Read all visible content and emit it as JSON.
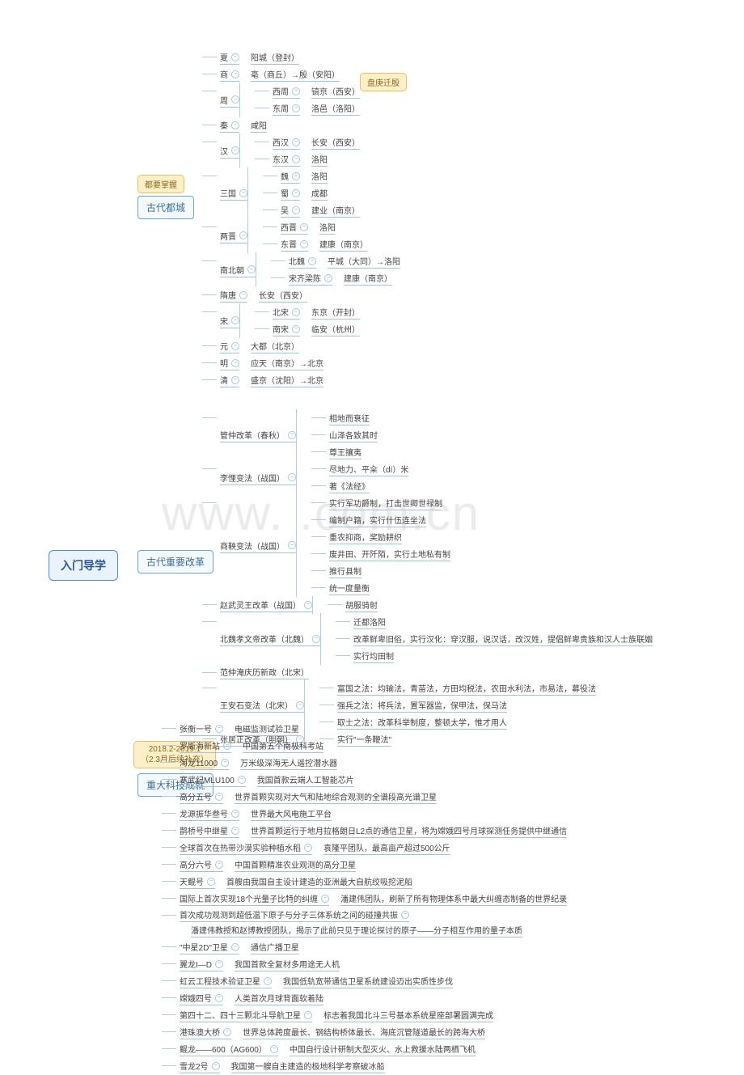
{
  "watermark": "www. .com.cn",
  "root": "入门导学",
  "branches": {
    "capitals": {
      "title": "古代都城",
      "badge": "都要掌握",
      "extra_badge": "盘庚迁殷",
      "items": [
        {
          "name": "夏",
          "cap": "阳城（登封）"
        },
        {
          "name": "商",
          "cap": "亳（商丘）→殷（安阳）"
        },
        {
          "name": "周",
          "children": [
            {
              "name": "西周",
              "cap": "镐京（西安）"
            },
            {
              "name": "东周",
              "cap": "洛邑（洛阳）"
            }
          ]
        },
        {
          "name": "秦",
          "cap": "咸阳"
        },
        {
          "name": "汉",
          "children": [
            {
              "name": "西汉",
              "cap": "长安（西安）"
            },
            {
              "name": "东汉",
              "cap": "洛阳"
            }
          ]
        },
        {
          "name": "三国",
          "children": [
            {
              "name": "魏",
              "cap": "洛阳"
            },
            {
              "name": "蜀",
              "cap": "成都"
            },
            {
              "name": "吴",
              "cap": "建业（南京）"
            }
          ]
        },
        {
          "name": "两晋",
          "children": [
            {
              "name": "西晋",
              "cap": "洛阳"
            },
            {
              "name": "东晋",
              "cap": "建康（南京）"
            }
          ]
        },
        {
          "name": "南北朝",
          "children": [
            {
              "name": "北魏",
              "cap": "平城（大同）→洛阳"
            },
            {
              "name": "宋齐梁陈",
              "cap": "建康（南京）"
            }
          ]
        },
        {
          "name": "隋唐",
          "cap": "长安（西安）"
        },
        {
          "name": "宋",
          "children": [
            {
              "name": "北宋",
              "cap": "东京（开封）"
            },
            {
              "name": "南宋",
              "cap": "临安（杭州）"
            }
          ]
        },
        {
          "name": "元",
          "cap": "大都（北京）"
        },
        {
          "name": "明",
          "cap": "应天（南京）→北京"
        },
        {
          "name": "清",
          "cap": "盛京（沈阳）→北京"
        }
      ]
    },
    "reforms": {
      "title": "古代重要改革",
      "items": [
        {
          "name": "管仲改革（春秋）",
          "details": [
            "相地而衰征",
            "山泽各致其时",
            "尊王攘夷"
          ]
        },
        {
          "name": "李悝变法（战国）",
          "details": [
            "尽地力、平籴（dí）米",
            "著《法经》"
          ]
        },
        {
          "name": "商鞅变法（战国）",
          "details": [
            "实行军功爵制，打击世卿世禄制",
            "编制户籍，实行什伍连坐法",
            "重农抑商，奖励耕织",
            "废井田、开阡陌，实行土地私有制",
            "推行县制",
            "统一度量衡"
          ]
        },
        {
          "name": "赵武灵王改革（战国）",
          "details": [
            "胡服骑射"
          ]
        },
        {
          "name": "北魏孝文帝改革（北魏）",
          "details": [
            "迁都洛阳",
            "改革鲜卑旧俗，实行汉化：穿汉服，说汉话，改汉姓，提倡鲜卑贵族和汉人士族联姻",
            "实行均田制"
          ]
        },
        {
          "name": "范仲淹庆历新政（北宋）"
        },
        {
          "name": "王安石变法（北宋）",
          "details": [
            "富国之法：均输法，青苗法，方田均税法，农田水利法，市易法，募役法",
            "强兵之法：将兵法，置军器监，保甲法，保马法",
            "取士之法：改革科举制度，整顿太学，惟才用人"
          ]
        },
        {
          "name": "张居正改革（明朝）",
          "details": [
            "实行\"一条鞭法\""
          ]
        }
      ]
    },
    "tech": {
      "title": "重大科技成就",
      "badge": "2018.2-2019.1\n（2.3月后续补充）",
      "items": [
        {
          "name": "张衡一号",
          "desc": "电磁监测试验卫星"
        },
        {
          "name": "罗斯海新站",
          "desc": "中国第五个南极科考站"
        },
        {
          "name": "海龙11000",
          "desc": "万米级深海无人遥控潜水器"
        },
        {
          "name": "寒武纪MLU100",
          "desc": "我国首款云端人工智能芯片"
        },
        {
          "name": "高分五号",
          "desc": "世界首颗实现对大气和陆地综合观测的全谱段高光谱卫星"
        },
        {
          "name": "龙源振华叁号",
          "desc": "世界最大风电施工平台"
        },
        {
          "name": "鹊桥号中继星",
          "desc": "世界首颗运行于地月拉格朗日L2点的通信卫星，将为嫦娥四号月球探测任务提供中继通信"
        },
        {
          "name": "全球首次在热带沙漠实验种植水稻",
          "desc": "袁隆平团队，最高亩产超过500公斤"
        },
        {
          "name": "高分六号",
          "desc": "中国首颗精准农业观测的高分卫星"
        },
        {
          "name": "天鲲号",
          "desc": "首艘由我国自主设计建造的亚洲最大自航绞吸挖泥船"
        },
        {
          "name": "国际上首次实现18个光量子比特的纠缠",
          "desc": "潘建伟团队，刷新了所有物理体系中最大纠缠态制备的世界纪录"
        },
        {
          "name": "首次成功观测到超低温下原子与分子三体系统之间的碰撞共振",
          "desc": "潘建伟教授和赵博教授团队，揭示了此前只见于理论探讨的原子——分子相互作用的量子本质"
        },
        {
          "name": "\"中星2D\"卫星",
          "desc": "通信广播卫星"
        },
        {
          "name": "翼龙I—D",
          "desc": "我国首款全复材多用途无人机"
        },
        {
          "name": "虹云工程技术验证卫星",
          "desc": "我国低轨宽带通信卫星系统建设迈出实质性步伐"
        },
        {
          "name": "嫦娥四号",
          "desc": "人类首次月球背面软着陆"
        },
        {
          "name": "第四十二、四十三颗北斗导航卫星",
          "desc": "标志着我国北斗三号基本系统星座部署圆满完成"
        },
        {
          "name": "港珠澳大桥",
          "desc": "世界总体跨度最长、钢结构桥体最长、海底沉管隧道最长的跨海大桥"
        },
        {
          "name": "鲲龙——600（AG600）",
          "desc": "中国自行设计研制大型灭火、水上救援水陆两栖飞机"
        },
        {
          "name": "雪龙2号",
          "desc": "我国第一艘自主建造的极地科学考察破冰船"
        }
      ]
    }
  }
}
